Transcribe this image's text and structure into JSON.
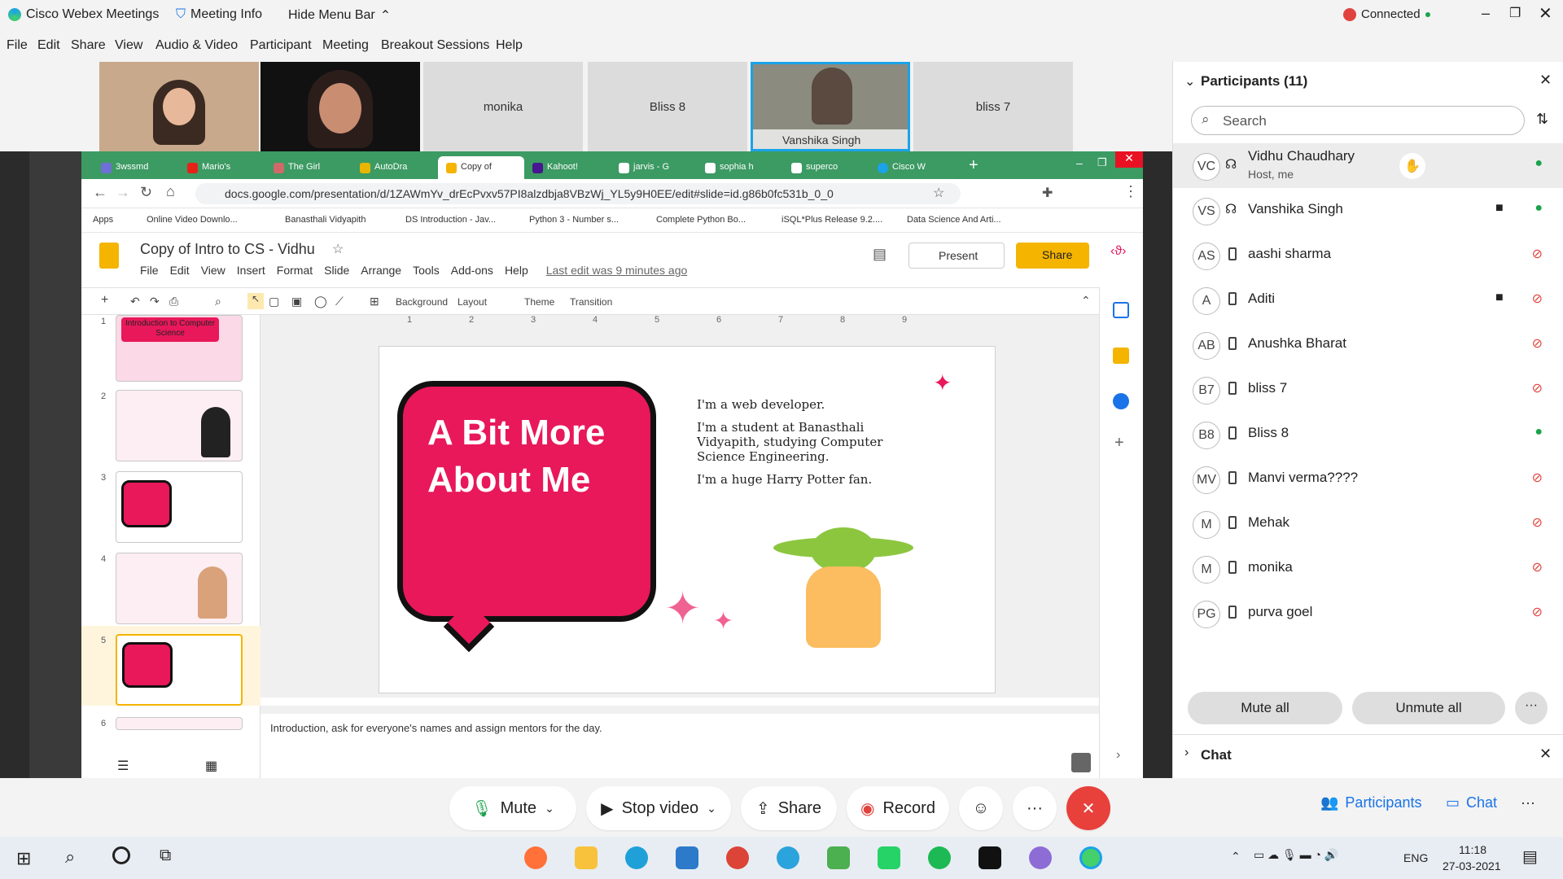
{
  "titlebar": {
    "app": "Cisco Webex Meetings",
    "meeting_info": "Meeting Info",
    "hide_menu": "Hide Menu Bar",
    "status": "Connected"
  },
  "menu": [
    "File",
    "Edit",
    "Share",
    "View",
    "Audio & Video",
    "Participant",
    "Meeting",
    "Breakout Sessions",
    "Help"
  ],
  "video_tiles": [
    {
      "label": ""
    },
    {
      "label": ""
    },
    {
      "label": "monika"
    },
    {
      "label": "Bliss 8"
    },
    {
      "label": "Vanshika Singh"
    },
    {
      "label": "bliss 7"
    }
  ],
  "browser": {
    "tabs": [
      "3wssmd",
      "Mario's",
      "The Girl",
      "AutoDra",
      "Copy of",
      "Kahoot!",
      "jarvis - G",
      "sophia h",
      "superco",
      "Cisco W"
    ],
    "url": "docs.google.com/presentation/d/1ZAWmYv_drEcPvxv57PI8alzdbja8VBzWj_YL5y9H0EE/edit#slide=id.g86b0fc531b_0_0",
    "bookmarks": [
      "Apps",
      "Online Video Downlo...",
      "Banasthali Vidyapith",
      "DS Introduction - Jav...",
      "Python 3 - Number s...",
      "Complete Python Bo...",
      "iSQL*Plus Release 9.2....",
      "Data Science And Arti..."
    ]
  },
  "slides": {
    "doc_title": "Copy of Intro to CS - Vidhu",
    "menus": [
      "File",
      "Edit",
      "View",
      "Insert",
      "Format",
      "Slide",
      "Arrange",
      "Tools",
      "Add-ons",
      "Help"
    ],
    "last_edit": "Last edit was 9 minutes ago",
    "present": "Present",
    "share": "Share",
    "toolbar": {
      "background": "Background",
      "layout": "Layout",
      "theme": "Theme",
      "transition": "Transition"
    },
    "ruler": [
      "1",
      "2",
      "3",
      "4",
      "5",
      "6",
      "7",
      "8",
      "9"
    ],
    "thumb_numbers": [
      "1",
      "2",
      "3",
      "4",
      "5",
      "6"
    ],
    "thumb1_title": "Introduction to Computer Science",
    "bubble_title": "A Bit More About Me",
    "lines": [
      "I'm a web developer.",
      "I'm a student at Banasthali Vidyapith, studying Computer Science Engineering.",
      "I'm a huge Harry Potter fan."
    ],
    "notes": "Introduction, ask for everyone's names and assign mentors for the day."
  },
  "participants": {
    "header": "Participants (11)",
    "search_placeholder": "Search",
    "list": [
      {
        "initials": "VC",
        "name": "Vidhu Chaudhary",
        "sub": "Host, me",
        "mic": "on"
      },
      {
        "initials": "VS",
        "name": "Vanshika Singh",
        "sub": "",
        "mic": "on"
      },
      {
        "initials": "AS",
        "name": "aashi sharma",
        "sub": "",
        "mic": "muted"
      },
      {
        "initials": "A",
        "name": "Aditi",
        "sub": "",
        "mic": "muted"
      },
      {
        "initials": "AB",
        "name": "Anushka Bharat",
        "sub": "",
        "mic": "muted"
      },
      {
        "initials": "B7",
        "name": "bliss 7",
        "sub": "",
        "mic": "muted"
      },
      {
        "initials": "B8",
        "name": "Bliss 8",
        "sub": "",
        "mic": "on"
      },
      {
        "initials": "MV",
        "name": "Manvi verma????",
        "sub": "",
        "mic": "muted"
      },
      {
        "initials": "M",
        "name": "Mehak",
        "sub": "",
        "mic": "muted"
      },
      {
        "initials": "M",
        "name": "monika",
        "sub": "",
        "mic": "muted"
      },
      {
        "initials": "PG",
        "name": "purva goel",
        "sub": "",
        "mic": "muted"
      }
    ],
    "mute_all": "Mute all",
    "unmute_all": "Unmute all",
    "chat_label": "Chat"
  },
  "controls": {
    "mute": "Mute",
    "stop_video": "Stop video",
    "share": "Share",
    "record": "Record",
    "participants": "Participants",
    "chat": "Chat"
  },
  "taskbar": {
    "lang": "ENG",
    "time": "11:18",
    "date": "27-03-2021"
  },
  "colors": {
    "pink": "#e8185a",
    "green_tab": "#3c9a63",
    "mic_on": "#1aa34a",
    "muted": "#e0433e",
    "end": "#e8403b"
  }
}
